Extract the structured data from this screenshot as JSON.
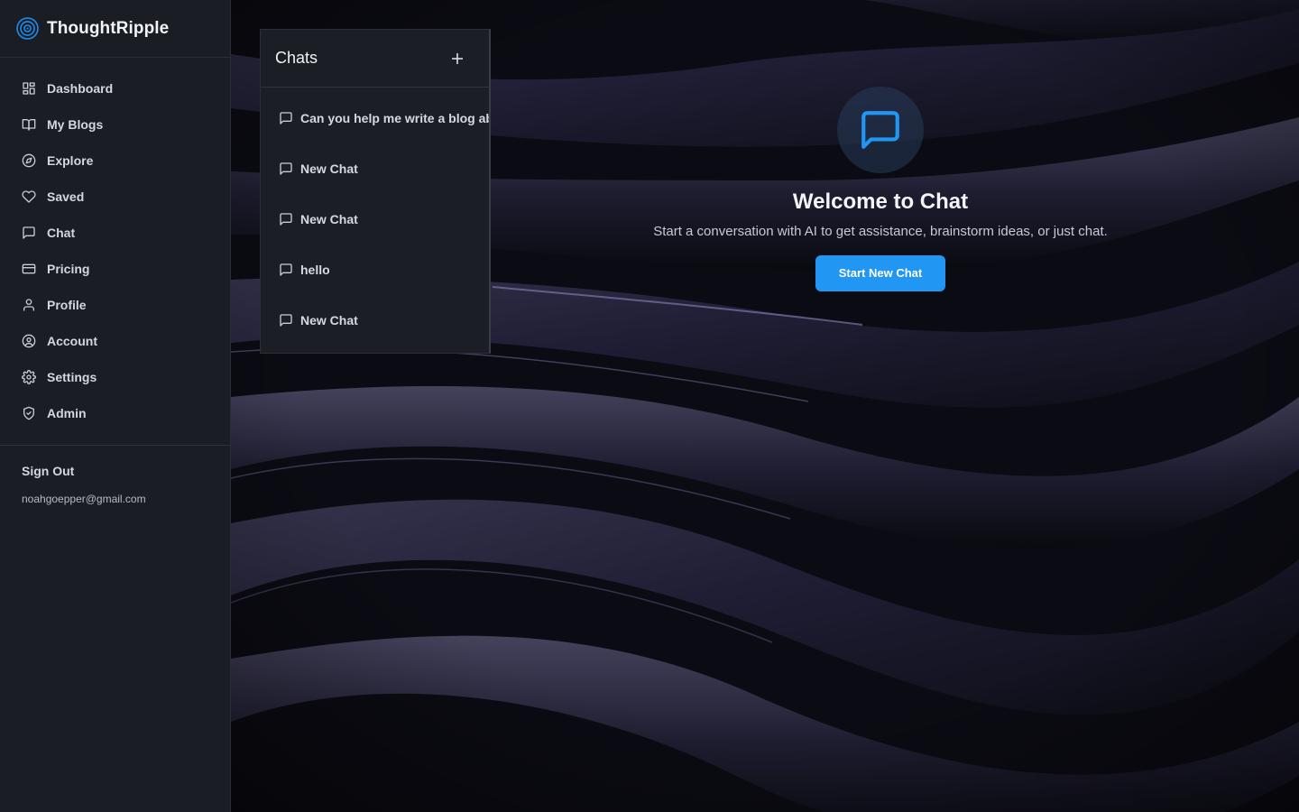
{
  "brand": {
    "name": "ThoughtRipple",
    "logo_icon": "ripple-logo-icon",
    "accent_color": "#1e88e5"
  },
  "sidebar": {
    "items": [
      {
        "label": "Dashboard",
        "icon": "grid-icon"
      },
      {
        "label": "My Blogs",
        "icon": "book-icon"
      },
      {
        "label": "Explore",
        "icon": "compass-icon"
      },
      {
        "label": "Saved",
        "icon": "heart-icon"
      },
      {
        "label": "Chat",
        "icon": "message-square-icon"
      },
      {
        "label": "Pricing",
        "icon": "credit-card-icon"
      },
      {
        "label": "Profile",
        "icon": "user-icon"
      },
      {
        "label": "Account",
        "icon": "user-circle-icon"
      },
      {
        "label": "Settings",
        "icon": "gear-icon"
      },
      {
        "label": "Admin",
        "icon": "shield-icon"
      }
    ],
    "sign_out_label": "Sign Out",
    "user_email": "noahgoepper@gmail.com"
  },
  "chats": {
    "title": "Chats",
    "new_chat_icon": "plus-icon",
    "items": [
      {
        "title": "Can you help me write a blog abo",
        "icon": "message-square-icon"
      },
      {
        "title": "New Chat",
        "icon": "message-square-icon"
      },
      {
        "title": "New Chat",
        "icon": "message-square-icon"
      },
      {
        "title": "hello",
        "icon": "message-square-icon"
      },
      {
        "title": "New Chat",
        "icon": "message-square-icon"
      }
    ]
  },
  "welcome": {
    "icon": "message-square-icon",
    "title": "Welcome to Chat",
    "subtitle": "Start a conversation with AI to get assistance, brainstorm ideas, or just chat.",
    "button_label": "Start New Chat",
    "button_color": "#2196f3"
  }
}
